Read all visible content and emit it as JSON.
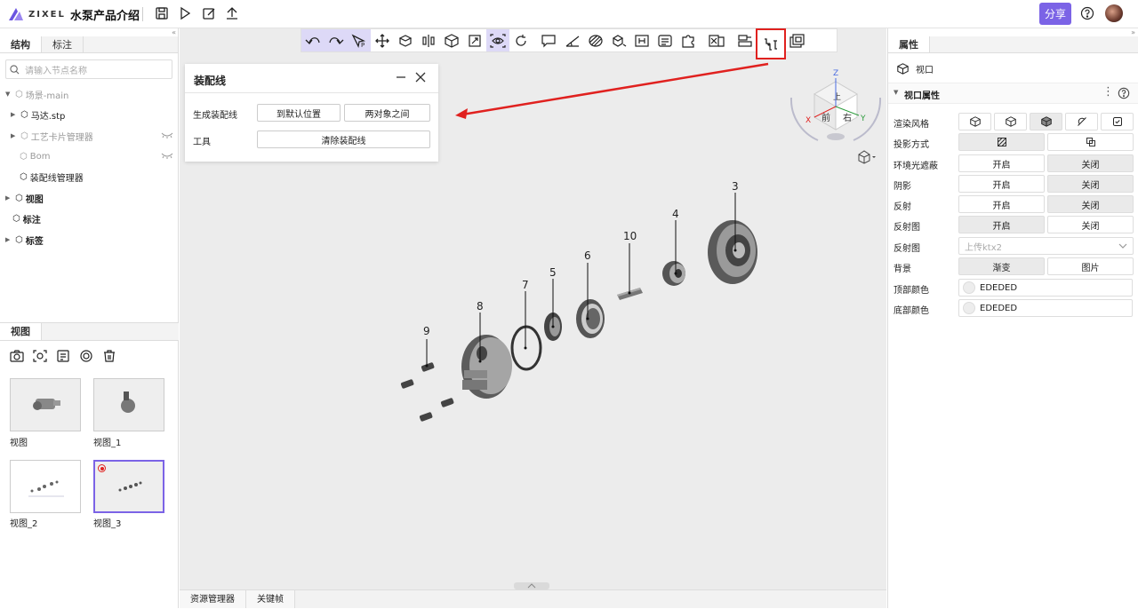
{
  "topbar": {
    "logo_text": "ZIXEL",
    "title": "水泵产品介绍",
    "share_label": "分享"
  },
  "left": {
    "tabs": [
      "结构",
      "标注"
    ],
    "search_placeholder": "请输入节点名称",
    "tree": [
      {
        "label": "场景-main"
      },
      {
        "label": "马达.stp"
      },
      {
        "label": "工艺卡片管理器"
      },
      {
        "label": "Bom"
      },
      {
        "label": "装配线管理器"
      },
      {
        "label": "视图"
      },
      {
        "label": "标注"
      },
      {
        "label": "标签"
      }
    ],
    "view_tab": "视图",
    "thumbs": [
      "视图",
      "视图_1",
      "视图_2",
      "视图_3"
    ]
  },
  "dialog": {
    "title": "装配线",
    "row1_label": "生成装配线",
    "btn_default": "到默认位置",
    "btn_between": "两对象之间",
    "row2_label": "工具",
    "btn_clear": "清除装配线"
  },
  "viewcube": {
    "front": "前",
    "right": "右",
    "top": "上",
    "axis_x": "X",
    "axis_y": "Y",
    "axis_z": "Z"
  },
  "callouts": [
    "3",
    "4",
    "10",
    "6",
    "5",
    "7",
    "8",
    "9"
  ],
  "bottom": {
    "tabs": [
      "资源管理器",
      "关键帧"
    ]
  },
  "right": {
    "tab": "属性",
    "object": "视口",
    "section": "视口属性",
    "rows": {
      "render_style": "渲染风格",
      "projection": "投影方式",
      "ao": "环境光遮蔽",
      "shadow": "阴影",
      "reflection": "反射",
      "reflection_map": "反射图",
      "reflection_map2": "反射图",
      "background": "背景",
      "top_color": "顶部颜色",
      "bottom_color": "底部颜色"
    },
    "on": "开启",
    "off": "关闭",
    "upload_placeholder": "上传ktx2",
    "bg_gradient": "渐变",
    "bg_image": "图片",
    "top_color_value": "EDEDED",
    "bottom_color_value": "EDEDED"
  },
  "colors": {
    "accent": "#7b63e6",
    "arrow": "#e0211f",
    "viewport_bg": "#ececec"
  }
}
